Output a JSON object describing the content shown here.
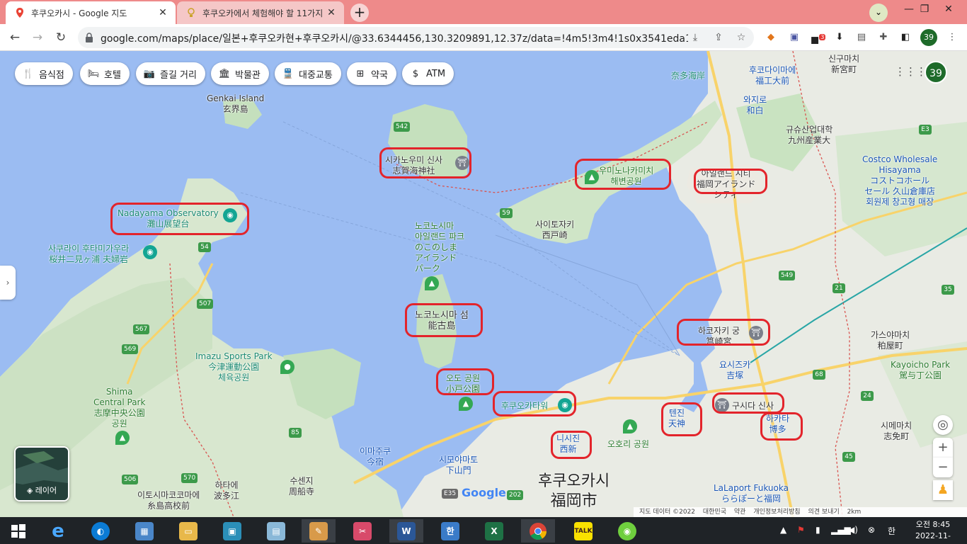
{
  "browser": {
    "tabs": [
      {
        "title": "후쿠오카시 - Google 지도",
        "active": true,
        "icon": "google-maps-icon"
      },
      {
        "title": "후쿠오카에서 체험해야 할 11가지",
        "active": false,
        "icon": "bulb-icon"
      }
    ],
    "new_tab": "+",
    "window": {
      "minimize": "—",
      "restore": "❐",
      "close": "✕"
    },
    "url": "google.com/maps/place/일본+후쿠오카현+후쿠오카시/@33.6344456,130.3209891,12.37z/data=!4m5!3m4!1s0x3541eda1e984842...",
    "extensions_badge": "3",
    "profile_number": "39"
  },
  "map": {
    "chips": [
      {
        "label": "음식점",
        "icon": "fork-knife-icon"
      },
      {
        "label": "호텔",
        "icon": "bed-icon"
      },
      {
        "label": "즐길 거리",
        "icon": "camera-icon"
      },
      {
        "label": "박물관",
        "icon": "museum-icon"
      },
      {
        "label": "대중교통",
        "icon": "train-icon"
      },
      {
        "label": "약국",
        "icon": "pharmacy-icon"
      },
      {
        "label": "ATM",
        "icon": "dollar-icon"
      }
    ],
    "labels": {
      "genkai": "Genkai Island\n玄界島",
      "shikanoumi": "시카노우미 신사\n志賀海神社",
      "uminonakamichi": "우미노나카미치\n해변공원",
      "island_city": "아일랜드 시티\n福岡アイランド\nシティ",
      "nadayama": "Nadayama Observatory\n灘山展望台",
      "sakurai": "사쿠라이 후타미가우라\n桜井二見ヶ浦 夫婦岩",
      "saitozaki": "사이토자키\n西戸崎",
      "nokonoshima_park": "노코노시마\n아일랜드 파크\nのこのしま\nアイランド\nパーク",
      "nokonoshima": "노코노시마 섬\n能古島",
      "hakozaki": "하코자키 궁\n筥崎宮",
      "imazu": "Imazu Sports Park\n今津運動公園\n체육공원",
      "shima_park": "Shima\nCentral Park\n志摩中央公園\n공원",
      "odo_park": "오도 공원\n小戸公園",
      "fukuoka_tower": "후쿠오카타워",
      "tenjin": "텐진\n天神",
      "kushida": "구시다 신사",
      "hakata": "하카타\n博多",
      "nishijin": "니시진\n西新",
      "ohori": "오호리 공원",
      "fukuoka_city": "후쿠오카시\n福岡市",
      "yoshizuka": "요시즈카\n吉塚",
      "kasuya": "가스야마치\n粕屋町",
      "kayoicho": "Kayoicho Park\n駕与丁公園",
      "shime": "시메마치\n志免町",
      "costco": "Costco Wholesale\nHisayama\nコストコホール\nセール 久山倉庫店\n회원제 창고형 매장",
      "kyushu_univ": "규슈산업대학\n九州産業大",
      "wajiro": "와지로\n和白",
      "kaikosaki": "나타해안",
      "shingu": "신구마치\n新宮町",
      "fukko": "후코다이마에\n福工大前",
      "imajuku": "이마주쿠\n今宿",
      "shimoyamato": "시모야마토\n下山門",
      "ito_high": "이토시마코코마에\n糸島高校前",
      "hatae": "하타에\n波多江",
      "shusenji": "수센지\n周船寺",
      "laport": "LaLaport Fukuoka\nららぽーと福岡",
      "nata": "奈多海岸"
    },
    "layers_label": "레이어",
    "footer": [
      "지도 데이터 ©2022",
      "대한민국",
      "약관",
      "개인정보처리방침",
      "의견 보내기",
      "2km"
    ],
    "google_logo": "Google",
    "route_numbers": [
      "542",
      "59",
      "54",
      "507",
      "567",
      "569",
      "85",
      "570",
      "506",
      "202",
      "E35",
      "549",
      "21",
      "35",
      "68",
      "24",
      "45",
      "E3",
      "3",
      "1",
      "4",
      "3"
    ]
  },
  "taskbar": {
    "clock_time": "오전 8:45",
    "clock_date": "2022-11-07",
    "ime": "한",
    "apps": [
      "windows-start",
      "internet-explorer",
      "edge",
      "control-panel",
      "file-explorer",
      "photos",
      "notepad",
      "paint",
      "snipping",
      "word",
      "hwp",
      "excel",
      "chrome",
      "kakaotalk",
      "line"
    ]
  }
}
